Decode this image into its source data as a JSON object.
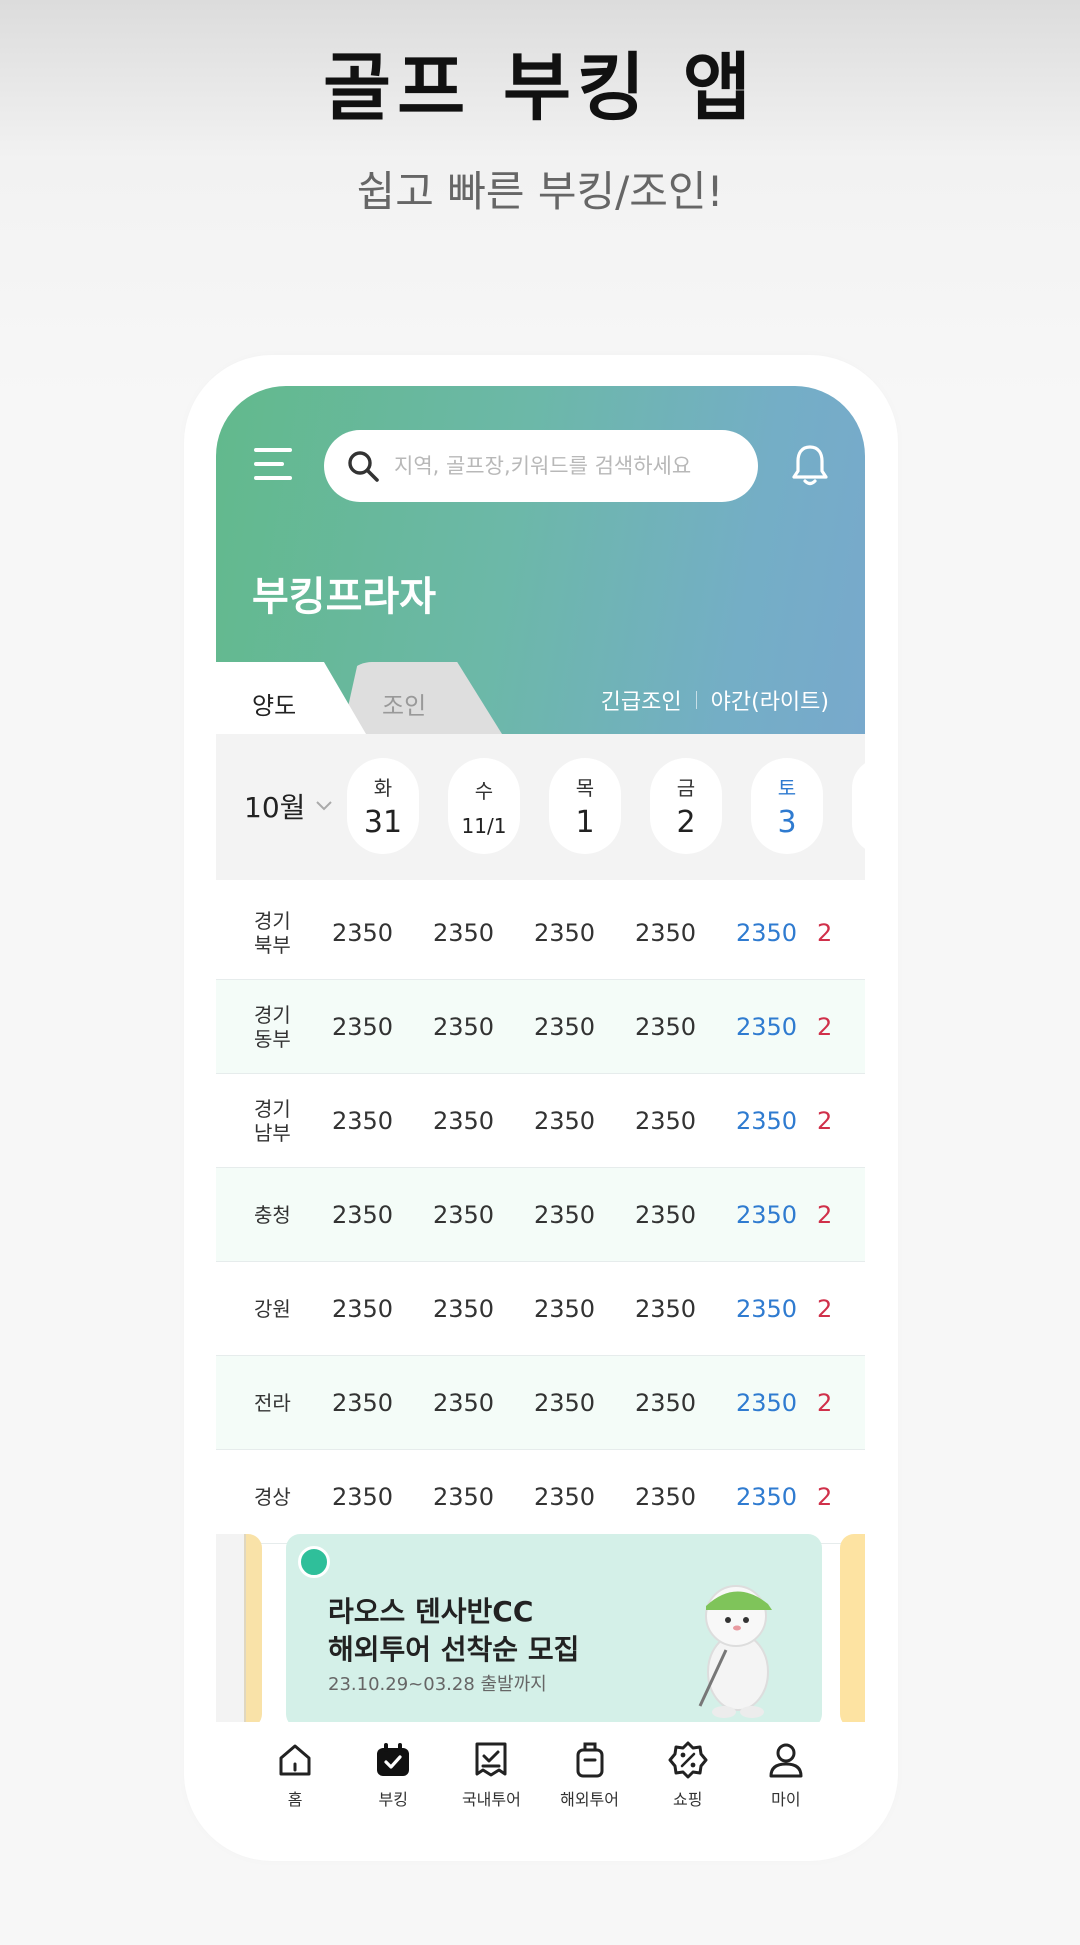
{
  "promo": {
    "title": "골프 부킹 앱",
    "subtitle": "쉽고 빠른 부킹/조인!"
  },
  "header": {
    "search_placeholder": "지역, 골프장,키워드를 검색하세요",
    "page_title": "부킹프라자",
    "gradient_colors": [
      "#62b98c",
      "#78a9cc"
    ]
  },
  "tabs": [
    {
      "label": "양도",
      "active": true
    },
    {
      "label": "조인",
      "active": false
    }
  ],
  "quick_links": [
    "긴급조인",
    "야간(라이트)"
  ],
  "calendar": {
    "month_label": "10월",
    "days": [
      {
        "dow": "화",
        "date": "31"
      },
      {
        "dow": "수",
        "date": "11/1"
      },
      {
        "dow": "목",
        "date": "1"
      },
      {
        "dow": "금",
        "date": "2"
      },
      {
        "dow": "토",
        "date": "3"
      }
    ]
  },
  "regions": [
    {
      "name": "경기 북부",
      "values": [
        "2350",
        "2350",
        "2350",
        "2350",
        "2350",
        "2"
      ]
    },
    {
      "name": "경기 동부",
      "values": [
        "2350",
        "2350",
        "2350",
        "2350",
        "2350",
        "2"
      ]
    },
    {
      "name": "경기 남부",
      "values": [
        "2350",
        "2350",
        "2350",
        "2350",
        "2350",
        "2"
      ]
    },
    {
      "name": "충청",
      "values": [
        "2350",
        "2350",
        "2350",
        "2350",
        "2350",
        "2"
      ]
    },
    {
      "name": "강원",
      "values": [
        "2350",
        "2350",
        "2350",
        "2350",
        "2350",
        "2"
      ]
    },
    {
      "name": "전라",
      "values": [
        "2350",
        "2350",
        "2350",
        "2350",
        "2350",
        "2"
      ]
    },
    {
      "name": "경상",
      "values": [
        "2350",
        "2350",
        "2350",
        "2350",
        "2350",
        "2"
      ]
    }
  ],
  "banner": {
    "line1": "라오스 덴사반CC",
    "line2": "해외투어 선착순 모집",
    "period": "23.10.29~03.28 출발까지"
  },
  "bottom_nav": [
    {
      "label": "홈",
      "icon": "home-icon",
      "active": false
    },
    {
      "label": "부킹",
      "icon": "calendar-check-icon",
      "active": true
    },
    {
      "label": "국내투어",
      "icon": "checklist-icon",
      "active": false
    },
    {
      "label": "해외투어",
      "icon": "luggage-icon",
      "active": false
    },
    {
      "label": "쇼핑",
      "icon": "discount-badge-icon",
      "active": false
    },
    {
      "label": "마이",
      "icon": "user-icon",
      "active": false
    }
  ],
  "colors": {
    "saturday": "#2f7bd0",
    "sunday": "#d0304a"
  }
}
